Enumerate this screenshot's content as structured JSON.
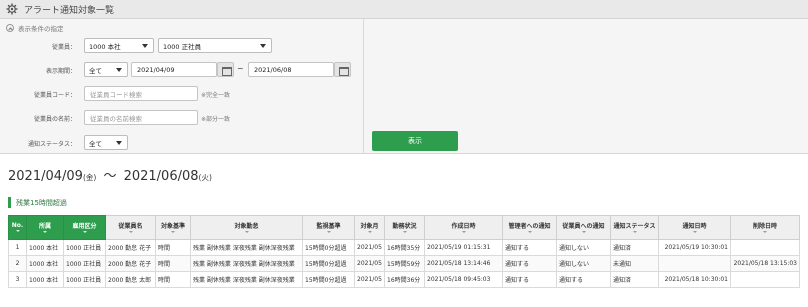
{
  "app": {
    "title": "アラート通知対象一覧",
    "icon": "gear-icon"
  },
  "filter": {
    "header": "表示条件の指定",
    "employee": {
      "label": "従業員：",
      "company": "1000 本社",
      "class": "1000 正社員"
    },
    "period": {
      "label": "表示期間：",
      "mode": "全て",
      "from": "2021/04/09",
      "tilde": "~",
      "to": "2021/06/08"
    },
    "code": {
      "label": "従業員コード：",
      "placeholder": "従業員コード検索",
      "note": "※完全一致"
    },
    "name": {
      "label": "従業員の名前：",
      "placeholder": "従業員の名前検索",
      "note": "※部分一致"
    },
    "status": {
      "label": "通知ステータス：",
      "value": "全て"
    },
    "show_button": "表示"
  },
  "period_display": {
    "from": "2021/04/09",
    "from_day": "(金)",
    "sep": "〜",
    "to": "2021/06/08",
    "to_day": "(火)"
  },
  "section_title": "残業15時間超過",
  "table": {
    "headers": [
      "No.",
      "所属",
      "雇用区分",
      "従業員名",
      "対象基準",
      "対象勤怠",
      "監視基準",
      "対象月",
      "勤務状況",
      "作成日時",
      "管理者への通知",
      "従業員への通知",
      "通知ステータス",
      "通知日時",
      "削除日時"
    ],
    "rows": [
      [
        "1",
        "1000 本社",
        "1000 正社員",
        "2000 勤怠 花子",
        "時間",
        "残業 副休残業 深夜残業 副休深夜残業",
        "15時間0分超過",
        "2021/05",
        "16時間35分",
        "2021/05/19 01:15:31",
        "通知する",
        "通知しない",
        "通知済",
        "2021/05/19 10:30:01",
        ""
      ],
      [
        "2",
        "1000 本社",
        "1000 正社員",
        "2000 勤怠 花子",
        "時間",
        "残業 副休残業 深夜残業 副休深夜残業",
        "15時間0分超過",
        "2021/05",
        "15時間59分",
        "2021/05/18 13:14:46",
        "通知する",
        "通知しない",
        "未通知",
        "",
        "2021/05/18 13:15:03"
      ],
      [
        "3",
        "1000 本社",
        "1000 正社員",
        "2000 勤怠 太郎",
        "時間",
        "残業 副休残業 深夜残業 副休深夜残業",
        "15時間0分超過",
        "2021/05",
        "16時間36分",
        "2021/05/18 09:45:03",
        "通知する",
        "通知する",
        "通知済",
        "2021/05/18 10:30:01",
        ""
      ]
    ]
  },
  "colors": {
    "accent": "#2e9e4e",
    "filter_bg": "#f5f5f5",
    "titlebar_bg": "#e9e9e9"
  }
}
